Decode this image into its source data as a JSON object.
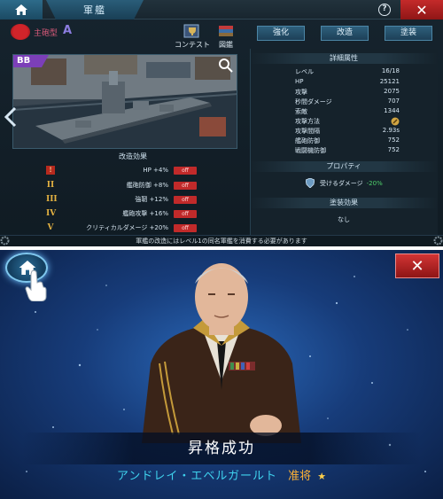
{
  "top": {
    "title": "軍艦",
    "help_glyph": "?",
    "close_glyph": "✕",
    "ship_type_label": "主砲型",
    "rank": "A",
    "ship_class_badge": "BB",
    "toolbar": {
      "contest_label": "コンテスト",
      "encyclopedia_label": "図鑑"
    },
    "buttons": {
      "strengthen": "強化",
      "modify": "改造",
      "paint": "塗装"
    },
    "modification": {
      "header": "改造効果",
      "items": [
        {
          "numeral": "!",
          "text": "HP +4%",
          "state": "off"
        },
        {
          "numeral": "II",
          "text": "艦砲防御 +8%",
          "state": "off"
        },
        {
          "numeral": "III",
          "text": "強靭 +12%",
          "state": "off"
        },
        {
          "numeral": "IV",
          "text": "艦砲攻撃 +16%",
          "state": "off"
        },
        {
          "numeral": "V",
          "text": "クリティカルダメージ +20%",
          "state": "off"
        }
      ]
    },
    "details": {
      "header": "詳細属性",
      "stats": [
        {
          "label": "レベル",
          "value": "16/18"
        },
        {
          "label": "HP",
          "value": "25121"
        },
        {
          "label": "攻撃",
          "value": "2075"
        },
        {
          "label": "秒間ダメージ",
          "value": "707"
        },
        {
          "label": "索敵",
          "value": "1344"
        },
        {
          "label": "攻撃方法",
          "value": ""
        },
        {
          "label": "攻撃間隔",
          "value": "2.93s"
        },
        {
          "label": "艦砲防御",
          "value": "752"
        },
        {
          "label": "戦闘機防御",
          "value": "752"
        }
      ]
    },
    "property": {
      "header": "プロパティ",
      "label": "受けるダメージ",
      "value": "-20%"
    },
    "coating": {
      "header": "塗装効果",
      "value": "なし"
    },
    "footer_note": "軍艦の改造にはレベル1の同名軍艦を消費する必要があります"
  },
  "bottom": {
    "close_glyph": "✕",
    "promo_text": "昇格成功",
    "officer_name": "アンドレイ・エベルガールト",
    "officer_rank": "准将",
    "star": "★"
  },
  "colors": {
    "accent_blue": "#2e5f7c",
    "close_red": "#c42a2a",
    "off_red": "#c12a2a",
    "green": "#4fd16b",
    "name_cyan": "#3fd2ee",
    "rank_gold": "#ffb235"
  }
}
